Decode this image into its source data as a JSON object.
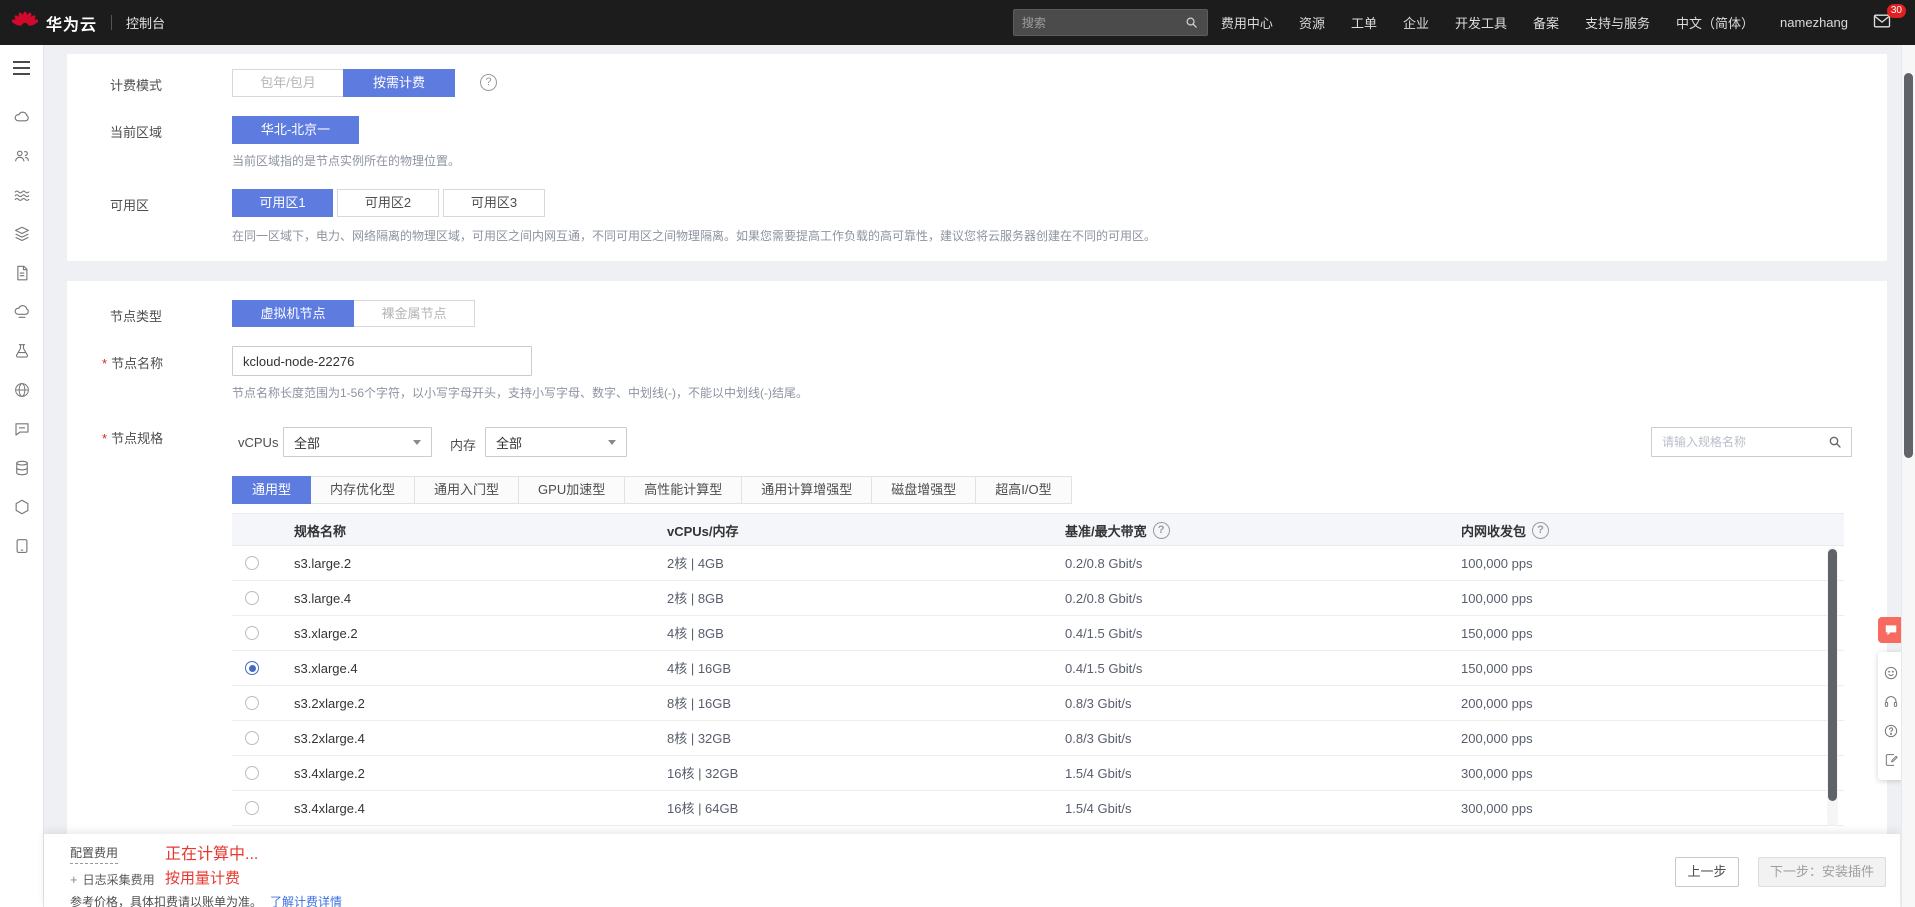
{
  "colors": {
    "accent": "#5e7ce0",
    "price_red": "#e8372f",
    "link_blue": "#3b6fe0",
    "badge_red": "#e02020",
    "brand_red": "#cf0a2c"
  },
  "icons": {
    "help_glyph": "?",
    "plus_glyph": "+"
  },
  "topbar": {
    "brand": "华为云",
    "console": "控制台",
    "search_placeholder": "搜索",
    "menu": [
      "费用中心",
      "资源",
      "工单",
      "企业",
      "开发工具",
      "备案",
      "支持与服务",
      "中文（简体）",
      "namezhang"
    ],
    "mail_badge": "30"
  },
  "form": {
    "required_mark": "*",
    "billing": {
      "label": "计费模式",
      "options": [
        "包年/包月",
        "按需计费"
      ],
      "selected": "按需计费"
    },
    "region": {
      "label": "当前区域",
      "value": "华北-北京一",
      "hint": "当前区域指的是节点实例所在的物理位置。"
    },
    "az": {
      "label": "可用区",
      "options": [
        "可用区1",
        "可用区2",
        "可用区3"
      ],
      "selected": "可用区1",
      "hint": "在同一区域下，电力、网络隔离的物理区域，可用区之间内网互通，不同可用区之间物理隔离。如果您需要提高工作负载的高可靠性，建议您将云服务器创建在不同的可用区。"
    },
    "node_type": {
      "label": "节点类型",
      "options": [
        "虚拟机节点",
        "裸金属节点"
      ],
      "selected": "虚拟机节点"
    },
    "node_name": {
      "label": "节点名称",
      "value": "kcloud-node-22276",
      "hint": "节点名称长度范围为1-56个字符，以小写字母开头，支持小写字母、数字、中划线(-)，不能以中划线(-)结尾。"
    },
    "node_spec": {
      "label": "节点规格",
      "vcpus_label": "vCPUs",
      "vcpus_value": "全部",
      "memory_label": "内存",
      "memory_value": "全部",
      "search_placeholder": "请输入规格名称",
      "tabs": [
        "通用型",
        "内存优化型",
        "通用入门型",
        "GPU加速型",
        "高性能计算型",
        "通用计算增强型",
        "磁盘增强型",
        "超高I/O型"
      ],
      "active_tab": "通用型",
      "table": {
        "headers": [
          "规格名称",
          "vCPUs/内存",
          "基准/最大带宽",
          "内网收发包"
        ],
        "rows": [
          {
            "name": "s3.large.2",
            "spec": "2核 | 4GB",
            "bandwidth": "0.2/0.8 Gbit/s",
            "pps": "100,000 pps"
          },
          {
            "name": "s3.large.4",
            "spec": "2核 | 8GB",
            "bandwidth": "0.2/0.8 Gbit/s",
            "pps": "100,000 pps"
          },
          {
            "name": "s3.xlarge.2",
            "spec": "4核 | 8GB",
            "bandwidth": "0.4/1.5 Gbit/s",
            "pps": "150,000 pps"
          },
          {
            "name": "s3.xlarge.4",
            "spec": "4核 | 16GB",
            "bandwidth": "0.4/1.5 Gbit/s",
            "pps": "150,000 pps"
          },
          {
            "name": "s3.2xlarge.2",
            "spec": "8核 | 16GB",
            "bandwidth": "0.8/3 Gbit/s",
            "pps": "200,000 pps"
          },
          {
            "name": "s3.2xlarge.4",
            "spec": "8核 | 32GB",
            "bandwidth": "0.8/3 Gbit/s",
            "pps": "200,000 pps"
          },
          {
            "name": "s3.4xlarge.2",
            "spec": "16核 | 32GB",
            "bandwidth": "1.5/4 Gbit/s",
            "pps": "300,000 pps"
          },
          {
            "name": "s3.4xlarge.4",
            "spec": "16核 | 64GB",
            "bandwidth": "1.5/4 Gbit/s",
            "pps": "300,000 pps"
          }
        ],
        "selected_row": "s3.xlarge.4"
      }
    }
  },
  "footer": {
    "cost_label": "配置费用",
    "cost_value": "正在计算中...",
    "log_label": "日志采集费用",
    "log_value": "按用量计费",
    "note": "参考价格，具体扣费请以账单为准。",
    "detail_link": "了解计费详情",
    "prev_button": "上一步",
    "next_button": "下一步：安装插件"
  }
}
